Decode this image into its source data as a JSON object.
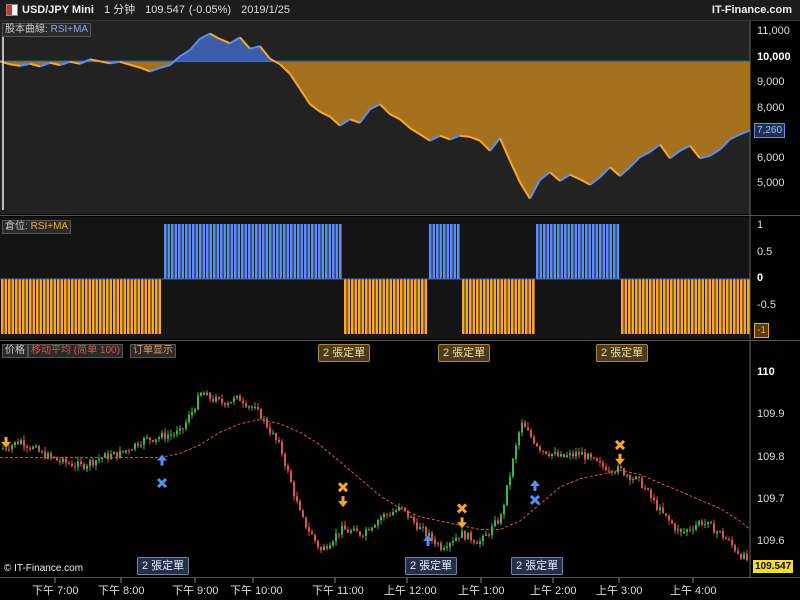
{
  "header": {
    "symbol": "USD/JPY Mini",
    "interval": "1 分钟",
    "price": "109.547",
    "change": "(-0.05%)",
    "date": "2019/1/25",
    "brand": "IT-Finance.com"
  },
  "colors": {
    "blue": "#5a8ef0",
    "orange": "#f6a632",
    "ma": "#d9534f",
    "up_candle": "#3fb24a",
    "down_candle": "#d9534f"
  },
  "panels": {
    "equity": {
      "tag_prefix": "股本曲線:",
      "tag_name": "RSI+MA",
      "axis_labels": [
        "11,000",
        "10,000",
        "9,000",
        "8,000",
        "7,260",
        "6,000",
        "5,000"
      ],
      "current": "7,260"
    },
    "position": {
      "tag_prefix": "倉位:",
      "tag_name": "RSI+MA",
      "axis_labels": [
        "1",
        "0.5",
        "0",
        "-0.5",
        "-1"
      ]
    },
    "price": {
      "tags": [
        "价格",
        "移动平均 (简单 100)",
        "订单显示"
      ],
      "axis_labels": [
        "110",
        "109.9",
        "109.8",
        "109.7",
        "109.6"
      ],
      "current": "109.547",
      "order_chip_label": "2 張定單"
    }
  },
  "time_axis": [
    "下午 7:00",
    "下午 8:00",
    "下午 9:00",
    "下午 10:00",
    "下午 11:00",
    "上午 12:00",
    "上午 1:00",
    "上午 2:00",
    "上午 3:00",
    "上午 4:00"
  ],
  "copyright": "© IT-Finance.com",
  "chart_data": [
    {
      "type": "area",
      "title": "股本曲線: RSI+MA",
      "baseline": 10000,
      "ylim": [
        4100,
        11600
      ],
      "x": [
        0,
        10,
        20,
        30,
        40,
        50,
        60,
        70,
        80,
        90,
        100,
        110,
        120,
        130,
        140,
        150,
        160,
        170,
        180,
        190,
        200,
        210,
        220,
        230,
        240,
        250,
        260,
        270,
        280,
        290,
        300,
        310,
        320,
        330,
        340,
        350,
        360,
        370,
        380,
        390,
        400,
        410,
        420,
        430,
        440,
        450,
        460,
        470,
        480,
        490,
        500,
        510,
        520,
        530,
        540,
        550,
        560,
        570,
        580,
        590,
        600,
        610,
        620,
        630,
        640,
        650,
        660,
        670,
        680,
        690,
        700,
        710,
        720,
        730,
        740,
        750
      ],
      "values": [
        10000,
        9880,
        9820,
        9900,
        9800,
        9940,
        9850,
        9980,
        9900,
        10080,
        10000,
        9920,
        9980,
        9860,
        9750,
        9600,
        9740,
        9850,
        10200,
        10450,
        10900,
        11100,
        10880,
        10720,
        10950,
        10500,
        10600,
        10100,
        9880,
        9500,
        8900,
        8300,
        8000,
        7800,
        7450,
        7700,
        7560,
        8100,
        8300,
        7900,
        7700,
        7350,
        7100,
        6850,
        7050,
        6900,
        7050,
        7000,
        6850,
        6450,
        6950,
        6050,
        5200,
        4550,
        5300,
        5600,
        5250,
        5500,
        5320,
        5100,
        5400,
        5800,
        5450,
        5800,
        6200,
        6400,
        6700,
        6150,
        6450,
        6650,
        6150,
        6250,
        6500,
        6900,
        7100,
        7260
      ]
    },
    {
      "type": "bar",
      "title": "倉位: RSI+MA",
      "ylim": [
        -1,
        1
      ],
      "series": [
        {
          "value": -1,
          "from": 0,
          "to": 163
        },
        {
          "value": 1,
          "from": 163,
          "to": 343
        },
        {
          "value": -1,
          "from": 343,
          "to": 428
        },
        {
          "value": 1,
          "from": 428,
          "to": 461
        },
        {
          "value": -1,
          "from": 461,
          "to": 535
        },
        {
          "value": 1,
          "from": 535,
          "to": 620
        },
        {
          "value": -1,
          "from": 620,
          "to": 750
        }
      ]
    },
    {
      "type": "line",
      "title": "USD/JPY Mini 1 分钟",
      "ylim": [
        109.53,
        110.04
      ],
      "x": [
        0,
        20,
        40,
        60,
        80,
        100,
        120,
        140,
        160,
        180,
        200,
        220,
        240,
        260,
        280,
        300,
        320,
        340,
        360,
        380,
        400,
        420,
        440,
        460,
        480,
        500,
        520,
        540,
        560,
        580,
        600,
        620,
        640,
        660,
        680,
        700,
        720,
        740,
        750
      ],
      "price": [
        109.82,
        109.84,
        109.81,
        109.79,
        109.78,
        109.8,
        109.81,
        109.84,
        109.85,
        109.86,
        109.95,
        109.93,
        109.94,
        109.9,
        109.82,
        109.66,
        109.58,
        109.63,
        109.62,
        109.66,
        109.68,
        109.63,
        109.59,
        109.62,
        109.6,
        109.66,
        109.88,
        109.82,
        109.8,
        109.81,
        109.78,
        109.77,
        109.74,
        109.67,
        109.62,
        109.65,
        109.62,
        109.57,
        109.55
      ],
      "ma": [
        109.8,
        109.8,
        109.8,
        109.8,
        109.8,
        109.8,
        109.8,
        109.8,
        109.8,
        109.81,
        109.83,
        109.86,
        109.88,
        109.89,
        109.88,
        109.86,
        109.83,
        109.79,
        109.75,
        109.71,
        109.68,
        109.66,
        109.65,
        109.64,
        109.63,
        109.63,
        109.65,
        109.69,
        109.73,
        109.75,
        109.76,
        109.77,
        109.76,
        109.74,
        109.72,
        109.7,
        109.68,
        109.65,
        109.63
      ],
      "orders": [
        {
          "type": "sell",
          "x": 6,
          "price": 109.83
        },
        {
          "type": "buy",
          "x": 162,
          "price": 109.8
        },
        {
          "type": "exit",
          "x": 162,
          "price": 109.74
        },
        {
          "type": "exit",
          "x": 343,
          "price": 109.73
        },
        {
          "type": "sell",
          "x": 343,
          "price": 109.69
        },
        {
          "type": "buy",
          "x": 428,
          "price": 109.61
        },
        {
          "type": "exit",
          "x": 428,
          "price": 109.55
        },
        {
          "type": "exit",
          "x": 462,
          "price": 109.68
        },
        {
          "type": "sell",
          "x": 462,
          "price": 109.64
        },
        {
          "type": "buy",
          "x": 535,
          "price": 109.74
        },
        {
          "type": "exit",
          "x": 535,
          "price": 109.7
        },
        {
          "type": "exit",
          "x": 620,
          "price": 109.83
        },
        {
          "type": "sell",
          "x": 620,
          "price": 109.79
        }
      ]
    }
  ]
}
